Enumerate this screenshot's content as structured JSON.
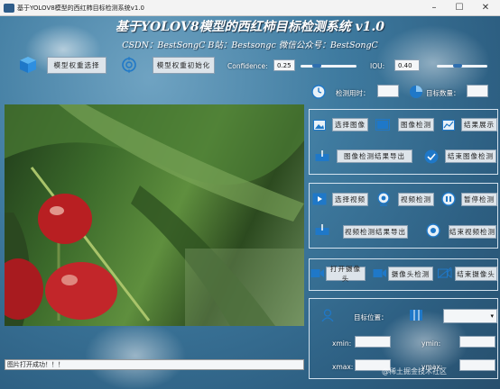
{
  "window": {
    "title": "基于YOLOV8模型的西红柿目标检测系统v1.0"
  },
  "header": {
    "title": "基于YOLOV8模型的西红柿目标检测系统 v1.0",
    "subtitle": "CSDN：BestSongC    B站：Bestsongc    微信公众号：BestSongC"
  },
  "toolbar": {
    "select_weights": "模型权重选择",
    "init_weights": "模型权重初始化",
    "confidence_label": "Confidence:",
    "confidence_value": "0.25",
    "iou_label": "IOU:",
    "iou_value": "0.40",
    "confidence_level": 0.25,
    "iou_level": 0.4
  },
  "stats": {
    "time_label": "检测用时：",
    "time_value": "",
    "count_label": "目标数量：",
    "count_value": ""
  },
  "image_group": {
    "select": "选择图像",
    "detect": "图像检测",
    "show": "结果展示",
    "export": "图像检测结果导出",
    "end": "结束图像检测"
  },
  "video_group": {
    "select": "选择视频",
    "detect": "视频检测",
    "pause": "暂停检测",
    "export": "视频检测结果导出",
    "end": "结束视频检测"
  },
  "camera_group": {
    "open": "打开摄像头",
    "detect": "摄像头检测",
    "end": "结束摄像头"
  },
  "target": {
    "label": "目标位置：",
    "select_value": ""
  },
  "coords": {
    "xmin_label": "xmin:",
    "xmin_value": "",
    "ymin_label": "ymin:",
    "ymin_value": "",
    "xmax_label": "xmax:",
    "xmax_value": "",
    "ymax_label": "ymax:",
    "ymax_value": ""
  },
  "status": {
    "text": "图片打开成功！！！"
  },
  "watermark": {
    "text": "@稀土掘金技术社区"
  },
  "colors": {
    "accent": "#2f6fb0",
    "tomato": "#c0262a"
  }
}
